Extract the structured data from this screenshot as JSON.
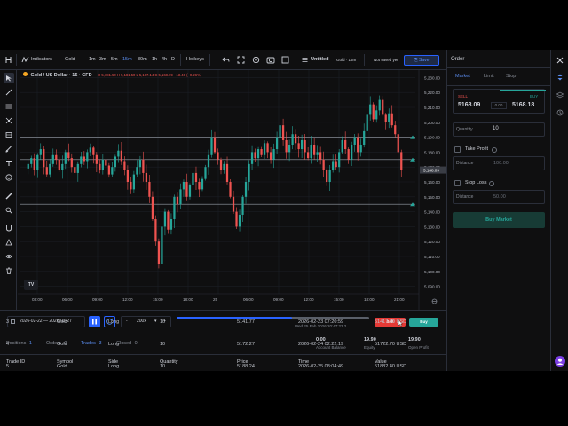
{
  "toolbar": {
    "indicators_label": "Indicators",
    "symbol": "Gold",
    "timeframes": [
      "1m",
      "3m",
      "5m",
      "15m",
      "30m",
      "1h",
      "4h",
      "D"
    ],
    "active_timeframe": "15m",
    "hotkeys_label": "Hotkeys",
    "layout_name": "Untitled",
    "layout_sub": "Gold · 15m",
    "not_saved": "Not saved yet",
    "save_label": "Save"
  },
  "chart": {
    "symbol_line": "Gold / US Dollar · 15 · CFD",
    "ohlc": "O 5,181.50  H 5,181.50  L 5,167.14  C 5,168.09  −13.40 (−0.26%)",
    "price_ticks": [
      "5,230.00",
      "5,220.00",
      "5,210.00",
      "5,200.00",
      "5,190.00",
      "5,180.00",
      "5,170.00",
      "5,160.00",
      "5,150.00",
      "5,140.00",
      "5,130.00",
      "5,120.00",
      "5,110.00",
      "5,100.00",
      "5,090.00"
    ],
    "last_price_label": "5,168.09",
    "time_ticks": [
      "03:00",
      "06:00",
      "09:00",
      "12:00",
      "15:00",
      "18:00",
      "25",
      "06:00",
      "09:00",
      "12:00",
      "15:00",
      "18:00",
      "21:00"
    ],
    "logo_text": "TV"
  },
  "chart_data": {
    "type": "candlestick",
    "symbol": "Gold / US Dollar",
    "interval": "15",
    "ylim": [
      5085,
      5235
    ],
    "close_path": [
      5172,
      5176,
      5168,
      5178,
      5182,
      5170,
      5165,
      5172,
      5178,
      5175,
      5168,
      5172,
      5180,
      5176,
      5170,
      5166,
      5172,
      5177,
      5174,
      5180,
      5183,
      5178,
      5172,
      5168,
      5175,
      5171,
      5165,
      5170,
      5177,
      5181,
      5174,
      5168,
      5160,
      5155,
      5165,
      5170,
      5175,
      5166,
      5160,
      5150,
      5135,
      5120,
      5105,
      5130,
      5140,
      5128,
      5135,
      5150,
      5145,
      5155,
      5160,
      5150,
      5158,
      5166,
      5160,
      5155,
      5162,
      5170,
      5178,
      5190,
      5180,
      5175,
      5168,
      5172,
      5160,
      5150,
      5140,
      5130,
      5138,
      5150,
      5160,
      5172,
      5180,
      5176,
      5182,
      5178,
      5186,
      5180,
      5175,
      5182,
      5190,
      5198,
      5188,
      5180,
      5185,
      5192,
      5186,
      5182,
      5188,
      5180,
      5176,
      5185,
      5178,
      5180,
      5175,
      5168,
      5160,
      5168,
      5174,
      5170,
      5180,
      5188,
      5182,
      5175,
      5185,
      5190,
      5180,
      5185,
      5194,
      5205,
      5212,
      5202,
      5208,
      5215,
      5205,
      5200,
      5206,
      5198,
      5192,
      5180,
      5168
    ],
    "horizontal_levels": [
      5190,
      5175,
      5145
    ]
  },
  "replay": {
    "date_range": "2026-02-22 — 2026-02-27",
    "speed_minus": "-",
    "speed": "200x",
    "speed_plus": "+",
    "progress": 0.6,
    "timestamp": "Wed 25 Feb 2026 20:47:23.2",
    "sell_label": "Sell",
    "buy_label": "Buy"
  },
  "positions": {
    "tabs": [
      {
        "label": "Positions",
        "count": "1"
      },
      {
        "label": "Orders",
        "count": "0"
      },
      {
        "label": "Trades",
        "count": "3"
      },
      {
        "label": "Closed",
        "count": "0"
      }
    ],
    "account_balance": {
      "value": "0.00",
      "label": "Account Balance"
    },
    "equity": {
      "value": "19.90",
      "label": "Equity"
    },
    "open_profit": {
      "value": "19.90",
      "label": "Open Profit"
    },
    "columns": [
      "Trade ID",
      "Symbol",
      "Side",
      "Quantity",
      "Price",
      "Time",
      "Value"
    ],
    "rows": [
      [
        "3",
        "Gold",
        "Long",
        "10",
        "5141.77",
        "2026-02-23 07:20:59",
        "51417.70 USD"
      ],
      [
        "4",
        "Gold",
        "Long",
        "10",
        "5172.27",
        "2026-02-24 02:22:19",
        "51722.70 USD"
      ],
      [
        "5",
        "Gold",
        "Long",
        "10",
        "5188.24",
        "2026-02-25 08:04:49",
        "51882.40 USD"
      ]
    ]
  },
  "order": {
    "title": "Order",
    "tabs": [
      "Market",
      "Limit",
      "Stop"
    ],
    "sell_label": "SELL",
    "sell_price": "5168.09",
    "spread": "0.00",
    "buy_label": "BUY",
    "buy_price": "5168.18",
    "quantity_label": "Quantity",
    "quantity_value": "10",
    "take_profit_label": "Take Profit",
    "take_profit_distance_label": "Distance",
    "take_profit_distance": "100.00",
    "stop_loss_label": "Stop Loss",
    "stop_loss_distance_label": "Distance",
    "stop_loss_distance": "50.00",
    "buy_market_label": "Buy Market"
  },
  "colors": {
    "up": "#26a69a",
    "down": "#ef5350",
    "accent": "#2962ff",
    "background": "#0f0f10"
  }
}
